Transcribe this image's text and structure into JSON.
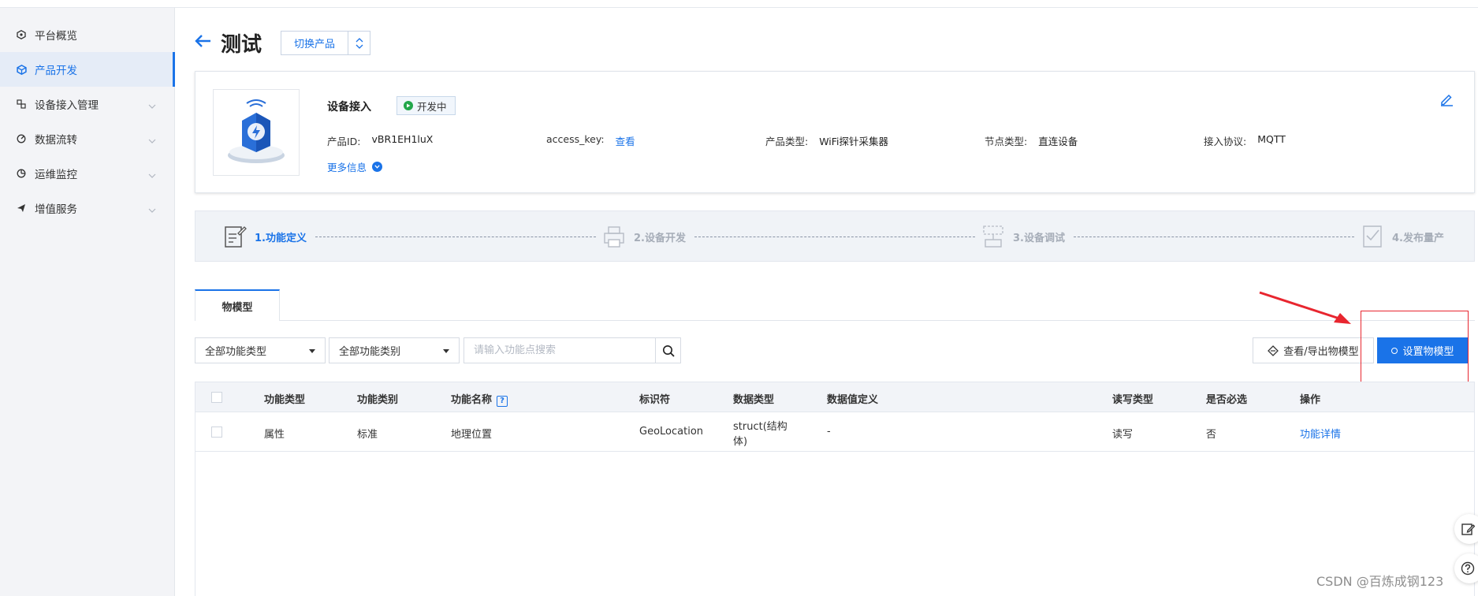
{
  "sidebar": {
    "items": [
      {
        "label": "平台概览",
        "icon": "platform-overview-icon",
        "active": false,
        "has_chevron": false
      },
      {
        "label": "产品开发",
        "icon": "product-cube-icon",
        "active": true,
        "has_chevron": false
      },
      {
        "label": "设备接入管理",
        "icon": "device-access-icon",
        "active": false,
        "has_chevron": true
      },
      {
        "label": "数据流转",
        "icon": "data-flow-icon",
        "active": false,
        "has_chevron": true
      },
      {
        "label": "运维监控",
        "icon": "ops-monitor-icon",
        "active": false,
        "has_chevron": true
      },
      {
        "label": "增值服务",
        "icon": "value-added-icon",
        "active": false,
        "has_chevron": true
      }
    ]
  },
  "header": {
    "title": "测试",
    "switch_label": "切换产品"
  },
  "product": {
    "name": "设备接入",
    "status": "开发中",
    "fields": [
      {
        "key": "产品ID:",
        "value": "vBR1EH1luX",
        "link": false
      },
      {
        "key": "access_key:",
        "value": "查看",
        "link": true
      },
      {
        "key": "产品类型:",
        "value": "WiFi探针采集器",
        "link": false
      },
      {
        "key": "节点类型:",
        "value": "直连设备",
        "link": false
      },
      {
        "key": "接入协议:",
        "value": "MQTT",
        "link": false
      }
    ],
    "more_label": "更多信息"
  },
  "steps": [
    {
      "label": "1.功能定义",
      "active": true
    },
    {
      "label": "2.设备开发",
      "active": false
    },
    {
      "label": "3.设备调试",
      "active": false
    },
    {
      "label": "4.发布量产",
      "active": false
    }
  ],
  "tabs": {
    "active": "物模型"
  },
  "filters": {
    "func_type": "全部功能类型",
    "func_category": "全部功能类别",
    "search_placeholder": "请输入功能点搜索"
  },
  "actions": {
    "view_export": "查看/导出物模型",
    "setup": "设置物模型"
  },
  "table": {
    "columns": [
      "功能类型",
      "功能类别",
      "功能名称",
      "标识符",
      "数据类型",
      "数据值定义",
      "读写类型",
      "是否必选",
      "操作"
    ],
    "rows": [
      {
        "func_type": "属性",
        "func_category": "标准",
        "func_name": "地理位置",
        "identifier": "GeoLocation",
        "data_type_line1": "struct(结构",
        "data_type_line2": "体)",
        "value_def": "-",
        "rw": "读写",
        "required": "否",
        "op": "功能详情"
      }
    ]
  },
  "colors": {
    "accent": "#1a73e8",
    "status_green": "#22a64a",
    "annotation_red": "#e8262f"
  },
  "watermark": "CSDN @百炼成钢123"
}
